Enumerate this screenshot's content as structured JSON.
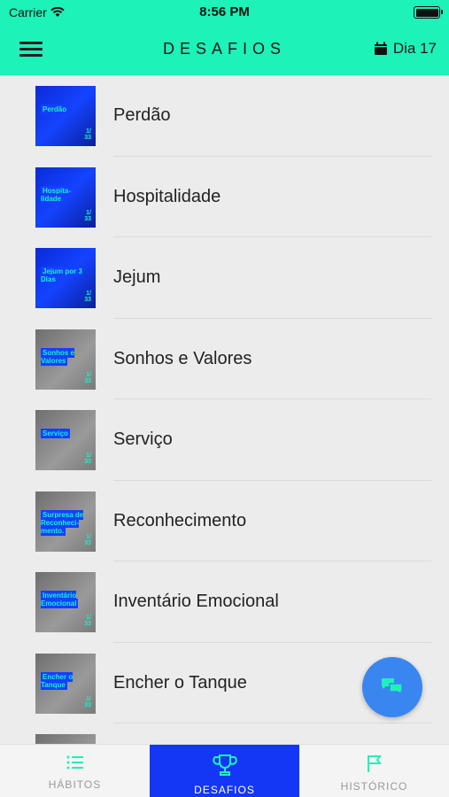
{
  "status": {
    "carrier": "Carrier",
    "time": "8:56 PM"
  },
  "nav": {
    "title": "DESAFIOS",
    "day": "Dia 17"
  },
  "challenges": [
    {
      "title": "Perdão",
      "thumb_text": "Perdão"
    },
    {
      "title": "Hospitalidade",
      "thumb_text": "Hospita-lidade"
    },
    {
      "title": "Jejum",
      "thumb_text": "Jejum por 3 Dias"
    },
    {
      "title": "Sonhos e Valores",
      "thumb_text": "Sonhos e Valores"
    },
    {
      "title": "Serviço",
      "thumb_text": "Serviço"
    },
    {
      "title": "Reconhecimento",
      "thumb_text": "Surpresa de Reconheci-mento."
    },
    {
      "title": "Inventário Emocional",
      "thumb_text": "Inventário Emocional"
    },
    {
      "title": "Encher o Tanque",
      "thumb_text": "Encher o Tanque"
    }
  ],
  "tabs": [
    {
      "label": "HÁBITOS",
      "icon": "list-icon",
      "active": false
    },
    {
      "label": "DESAFIOS",
      "icon": "trophy-icon",
      "active": true
    },
    {
      "label": "HISTÓRICO",
      "icon": "flag-icon",
      "active": false
    }
  ],
  "colors": {
    "header": "#1df2b8",
    "active_tab": "#1437f5",
    "fab": "#3a86f0"
  }
}
